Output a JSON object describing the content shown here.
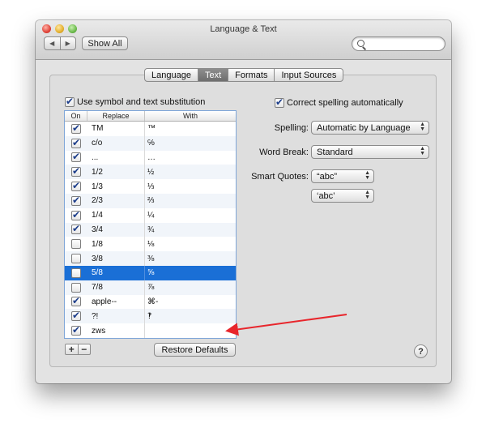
{
  "window": {
    "title": "Language & Text"
  },
  "toolbar": {
    "back_icon": "◀",
    "forward_icon": "▶",
    "show_all_label": "Show All",
    "search_placeholder": ""
  },
  "tabs": [
    {
      "label": "Language",
      "selected": false
    },
    {
      "label": "Text",
      "selected": true
    },
    {
      "label": "Formats",
      "selected": false
    },
    {
      "label": "Input Sources",
      "selected": false
    }
  ],
  "substitution": {
    "checkbox_label": "Use symbol and text substitution",
    "checked": true,
    "columns": {
      "on": "On",
      "replace": "Replace",
      "with": "With"
    },
    "rows": [
      {
        "on": true,
        "replace": "TM",
        "with": "™"
      },
      {
        "on": true,
        "replace": "c/o",
        "with": "℅"
      },
      {
        "on": true,
        "replace": "...",
        "with": "…"
      },
      {
        "on": true,
        "replace": "1/2",
        "with": "½"
      },
      {
        "on": true,
        "replace": "1/3",
        "with": "⅓"
      },
      {
        "on": true,
        "replace": "2/3",
        "with": "⅔"
      },
      {
        "on": true,
        "replace": "1/4",
        "with": "¼"
      },
      {
        "on": true,
        "replace": "3/4",
        "with": "¾"
      },
      {
        "on": false,
        "replace": "1/8",
        "with": "⅛"
      },
      {
        "on": false,
        "replace": "3/8",
        "with": "⅜"
      },
      {
        "on": false,
        "replace": "5/8",
        "with": "⅝",
        "selected": true
      },
      {
        "on": false,
        "replace": "7/8",
        "with": "⅞"
      },
      {
        "on": true,
        "replace": "apple--",
        "with": "⌘-"
      },
      {
        "on": true,
        "replace": "?!",
        "with": "‽"
      },
      {
        "on": true,
        "replace": "zws",
        "with": ""
      }
    ],
    "add_label": "+",
    "remove_label": "−",
    "restore_label": "Restore Defaults"
  },
  "spelling": {
    "correct_label": "Correct spelling automatically",
    "correct_checked": true,
    "spelling_label": "Spelling:",
    "spelling_value": "Automatic by Language",
    "word_break_label": "Word Break:",
    "word_break_value": "Standard",
    "smart_quotes_label": "Smart Quotes:",
    "double_quotes_value": "“abc”",
    "single_quotes_value": "‘abc’"
  },
  "help_label": "?",
  "annotation": {
    "arrow_color": "#e8262c"
  }
}
